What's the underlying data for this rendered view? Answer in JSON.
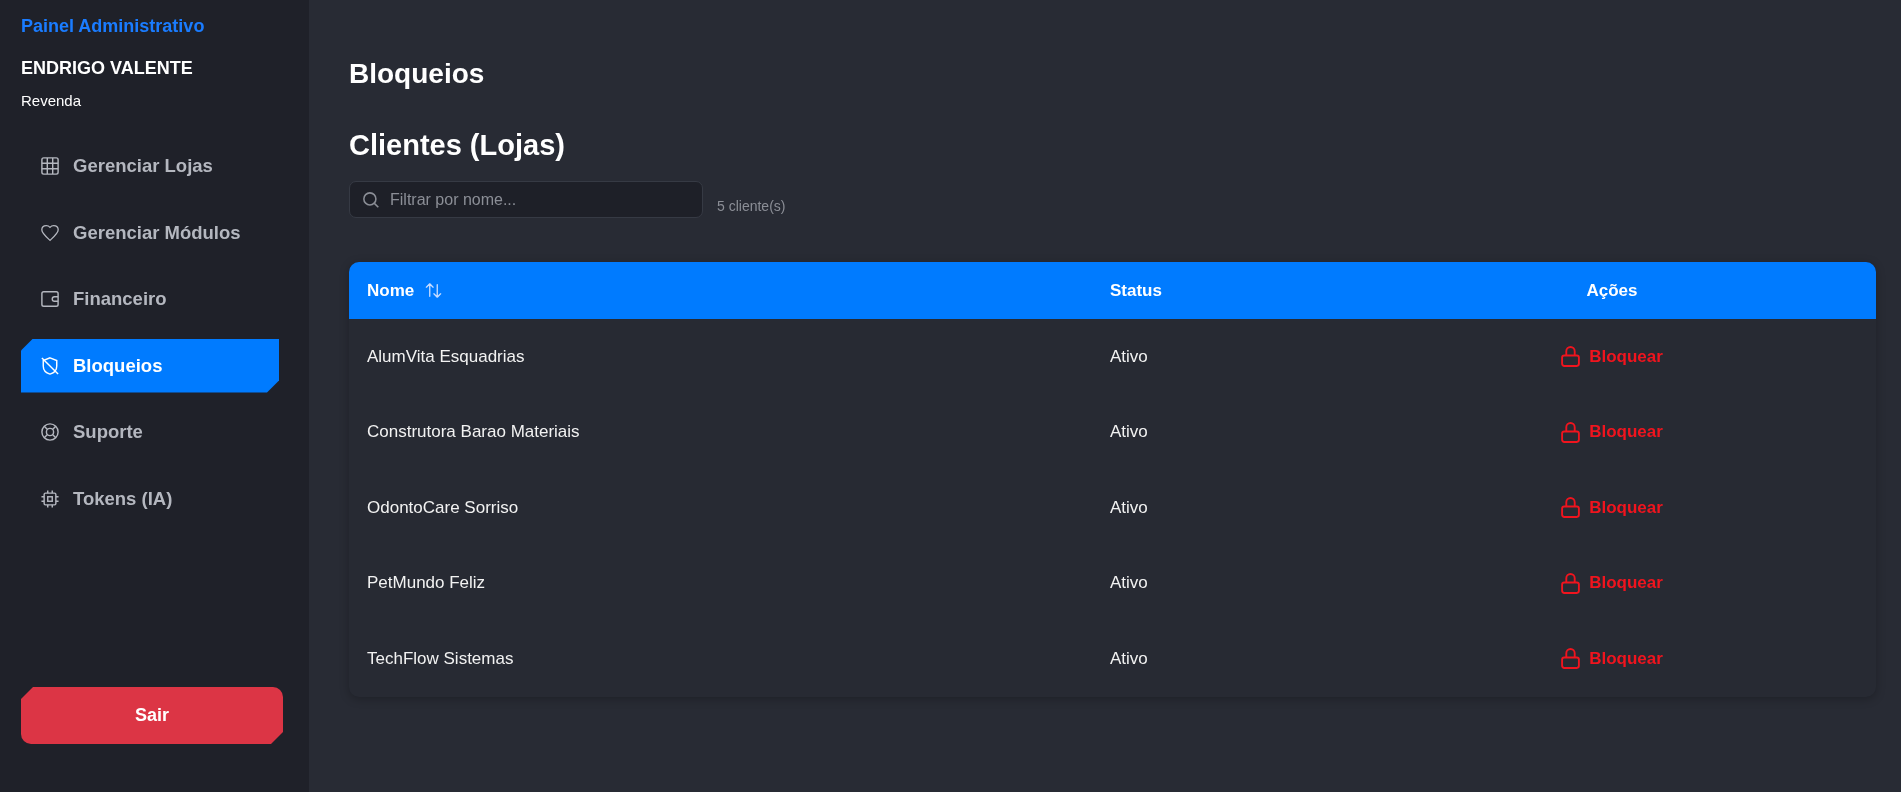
{
  "sidebar": {
    "title": "Painel Administrativo",
    "user_name": "ENDRIGO VALENTE",
    "user_role": "Revenda",
    "items": [
      {
        "label": "Gerenciar Lojas",
        "selected": false
      },
      {
        "label": "Gerenciar Módulos",
        "selected": false
      },
      {
        "label": "Financeiro",
        "selected": false
      },
      {
        "label": "Bloqueios",
        "selected": true
      },
      {
        "label": "Suporte",
        "selected": false
      },
      {
        "label": "Tokens (IA)",
        "selected": false
      }
    ],
    "logout_button": "Sair"
  },
  "page": {
    "title": "Bloqueios",
    "section_title": "Clientes (Lojas)",
    "search": {
      "placeholder": "Filtrar por nome..."
    },
    "result_count": "5 cliente(s)"
  },
  "table": {
    "columns": [
      {
        "label": "Nome",
        "sortable": true
      },
      {
        "label": "Status",
        "sortable": false
      },
      {
        "label": "Ações",
        "sortable": false
      }
    ],
    "rows": [
      {
        "name": "AlumVita Esquadrias",
        "status": "Ativo",
        "action": "Bloquear"
      },
      {
        "name": "Construtora Barao Materiais",
        "status": "Ativo",
        "action": "Bloquear"
      },
      {
        "name": "OdontoCare Sorriso",
        "status": "Ativo",
        "action": "Bloquear"
      },
      {
        "name": "PetMundo Feliz",
        "status": "Ativo",
        "action": "Bloquear"
      },
      {
        "name": "TechFlow Sistemas",
        "status": "Ativo",
        "action": "Bloquear"
      }
    ]
  }
}
